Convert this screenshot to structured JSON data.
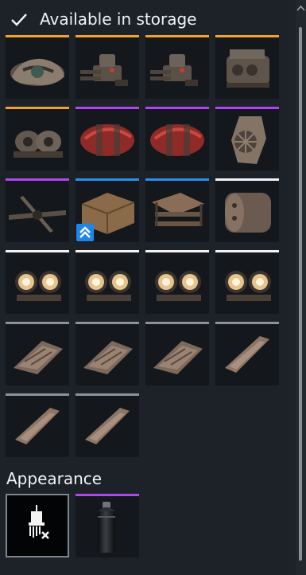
{
  "header": {
    "title": "Available in storage",
    "icon": "check-icon"
  },
  "colors": {
    "orange": "#f2a427",
    "purple": "#b145f3",
    "blue": "#2490f0",
    "white": "#f3f3f3",
    "gray": "#8e9196",
    "badge": "#1e86e8"
  },
  "items": [
    {
      "kind": "engine-pod",
      "rarity": "orange"
    },
    {
      "kind": "turret",
      "rarity": "orange"
    },
    {
      "kind": "turret",
      "rarity": "orange"
    },
    {
      "kind": "engine-block",
      "rarity": "orange"
    },
    {
      "kind": "twin-engine",
      "rarity": "orange"
    },
    {
      "kind": "red-tank",
      "rarity": "purple"
    },
    {
      "kind": "red-tank",
      "rarity": "purple"
    },
    {
      "kind": "cooler",
      "rarity": "purple"
    },
    {
      "kind": "rotor",
      "rarity": "purple"
    },
    {
      "kind": "crate",
      "rarity": "blue",
      "badge": "rank-up-icon"
    },
    {
      "kind": "sled",
      "rarity": "blue"
    },
    {
      "kind": "drum",
      "rarity": "white"
    },
    {
      "kind": "headlights",
      "rarity": "white"
    },
    {
      "kind": "headlights",
      "rarity": "white"
    },
    {
      "kind": "headlights",
      "rarity": "white"
    },
    {
      "kind": "headlights",
      "rarity": "white"
    },
    {
      "kind": "armor-plate",
      "rarity": "gray"
    },
    {
      "kind": "armor-plate",
      "rarity": "gray"
    },
    {
      "kind": "armor-plate",
      "rarity": "gray"
    },
    {
      "kind": "armor-strip",
      "rarity": "gray"
    },
    {
      "kind": "armor-strip",
      "rarity": "gray"
    },
    {
      "kind": "armor-strip",
      "rarity": "gray"
    }
  ],
  "appearance": {
    "label": "Appearance",
    "paint_icon": "paint-brush-remove-icon",
    "spray_rarity": "purple"
  }
}
